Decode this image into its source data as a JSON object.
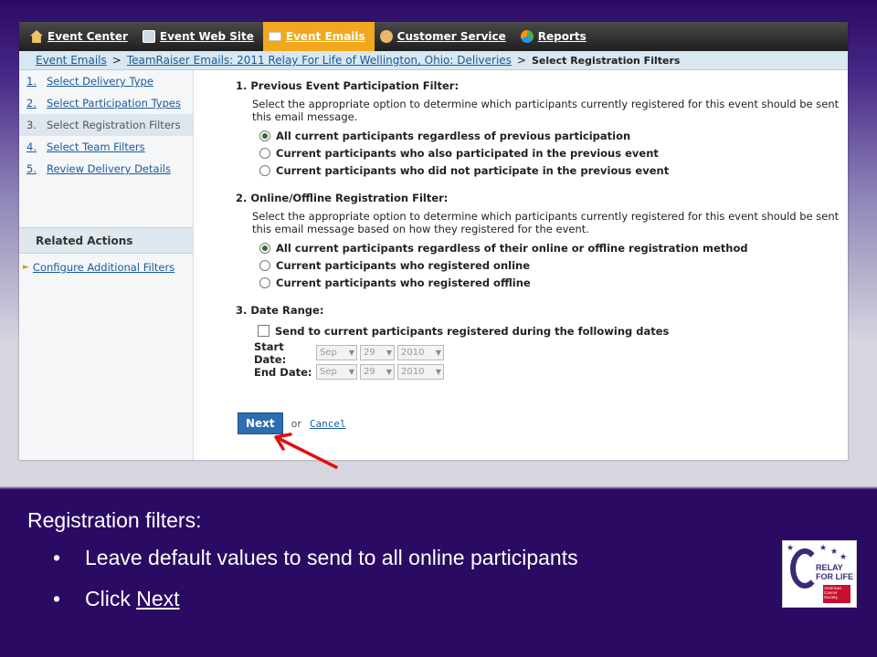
{
  "nav": {
    "items": [
      {
        "label": "Event Center",
        "icon": "home-icon"
      },
      {
        "label": "Event Web Site",
        "icon": "website-icon"
      },
      {
        "label": "Event Emails",
        "icon": "email-icon",
        "active": true
      },
      {
        "label": "Customer Service",
        "icon": "customer-service-icon"
      },
      {
        "label": "Reports",
        "icon": "reports-icon"
      }
    ]
  },
  "breadcrumb": {
    "link1": "Event Emails",
    "link2": "TeamRaiser Emails: 2011 Relay For Life of Wellington, Ohio: Deliveries",
    "sep": ">",
    "current": "Select Registration Filters"
  },
  "sidebar": {
    "steps": [
      {
        "num": "1.",
        "label": "Select Delivery Type"
      },
      {
        "num": "2.",
        "label": "Select Participation Types"
      },
      {
        "num": "3.",
        "label": "Select Registration Filters"
      },
      {
        "num": "4.",
        "label": "Select Team Filters"
      },
      {
        "num": "5.",
        "label": "Review Delivery Details"
      }
    ],
    "related_title": "Related Actions",
    "related_link": "Configure Additional Filters"
  },
  "main": {
    "sec1": {
      "title": "1.  Previous Event Participation Filter:",
      "desc": "Select the appropriate option to determine which participants currently registered for this event should be sent this email message.",
      "options": [
        "All current participants regardless of previous participation",
        "Current participants who also participated in the previous event",
        "Current participants who did not participate in the previous event"
      ]
    },
    "sec2": {
      "title": "2.  Online/Offline Registration Filter:",
      "desc": "Select the appropriate option to determine which participants currently registered for this event should be sent this email message based on how they registered for the event.",
      "options": [
        "All current participants regardless of their online or offline registration method",
        "Current participants who registered online",
        "Current participants who registered offline"
      ]
    },
    "sec3": {
      "title": "3.  Date Range:",
      "checkbox": "Send to current participants registered during the following dates",
      "start_label": "Start Date:",
      "end_label": "End Date:",
      "month": "Sep",
      "day": "29",
      "year": "2010"
    },
    "next_label": "Next",
    "or_text": "or",
    "cancel_label": "Cancel"
  },
  "caption": {
    "title": "Registration filters:",
    "bullet1": "Leave default values to send to all online participants",
    "bullet2_prefix": "Click ",
    "bullet2_link": "Next",
    "bullet_char": "•"
  },
  "logo": {
    "line1": "RELAY",
    "line2": "FOR LIFE",
    "acs": "American Cancer Society"
  }
}
